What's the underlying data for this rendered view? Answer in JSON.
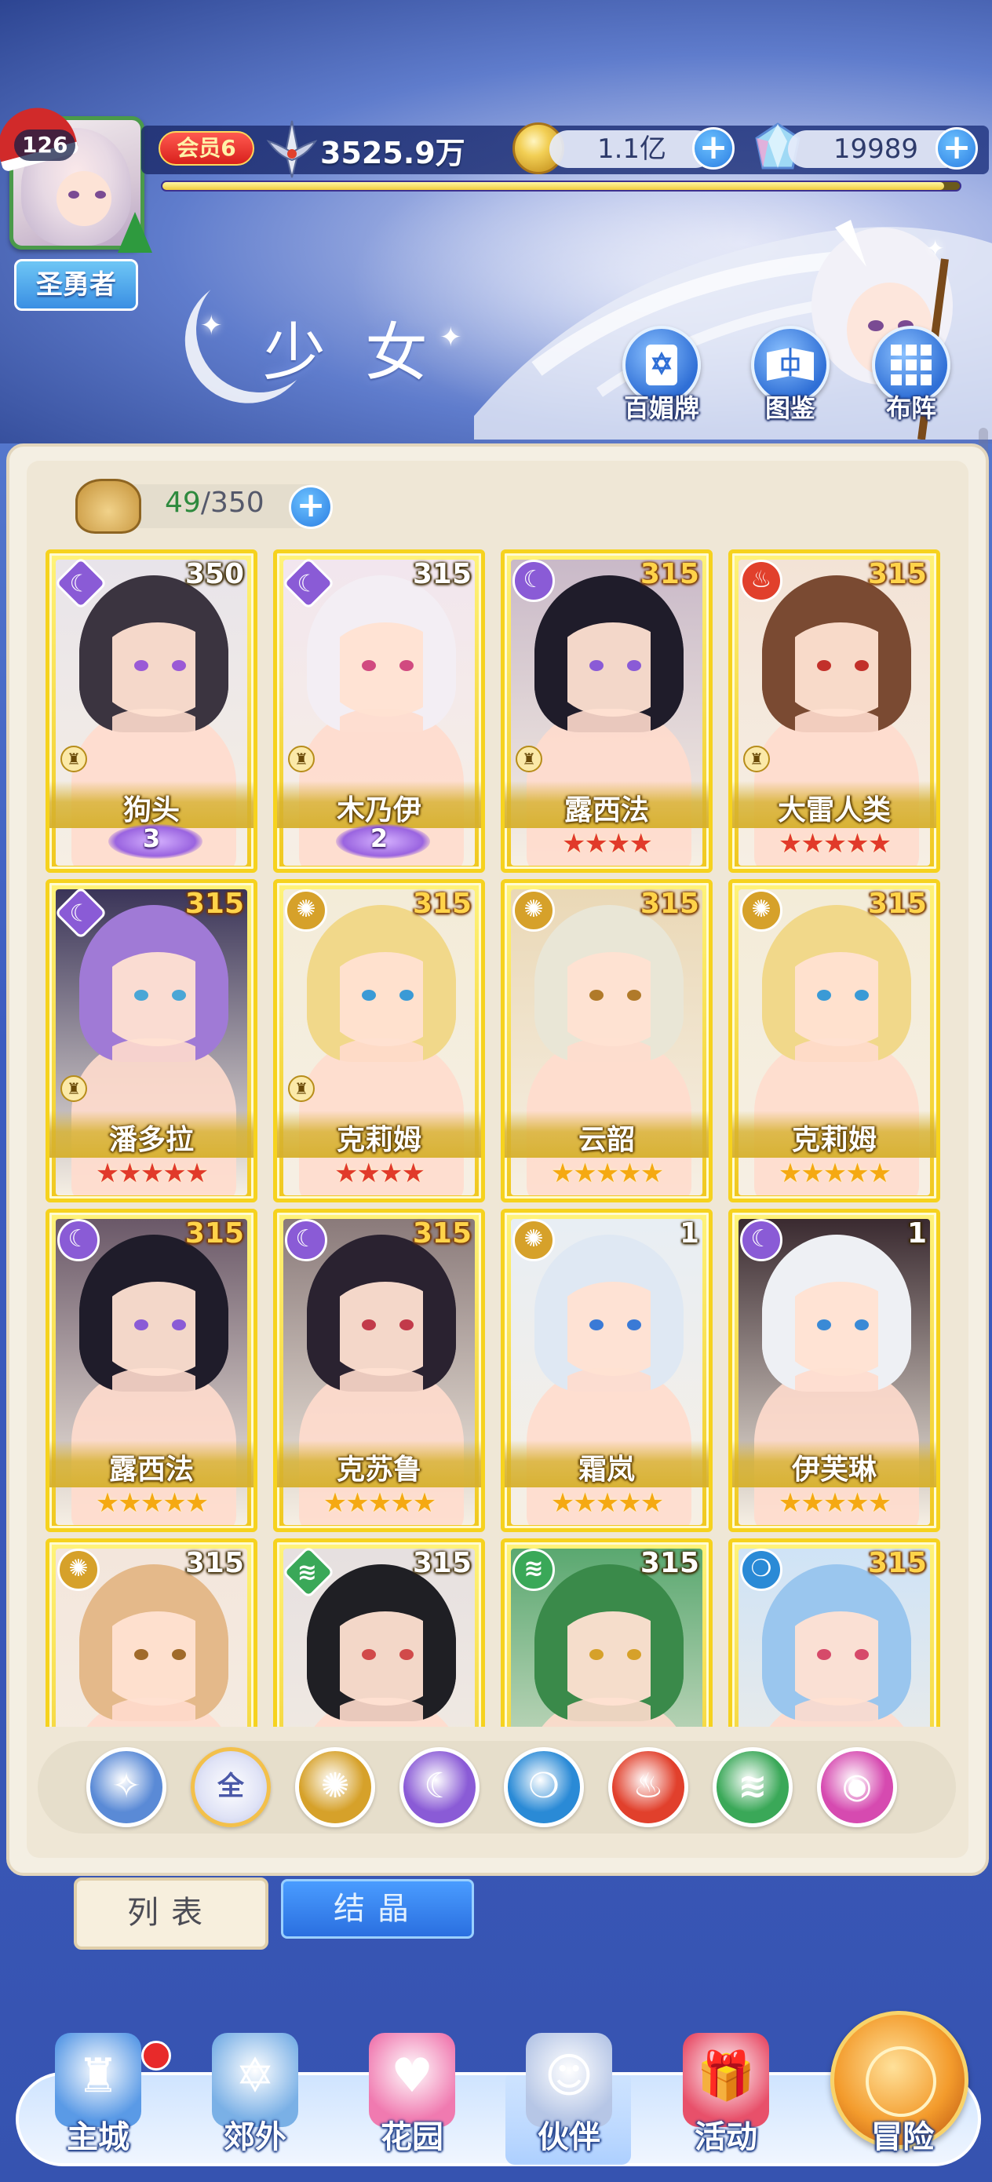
{
  "colors": {
    "card_gold": "#f0c81f",
    "moon_element": "#8a5bd6",
    "sun_element": "#d6a12a",
    "fire_element": "#e1402c",
    "wind_element": "#3aa858",
    "water_element": "#2a8ad6",
    "space_element": "#d64ab0",
    "ui_blue": "#2a7de2",
    "panel_cream": "#f4efe3"
  },
  "player": {
    "level": "126",
    "title": "圣勇者",
    "vip": "会员6",
    "power": "3525.9万",
    "gold": "1.1亿",
    "gems": "19989",
    "xp_fraction": 0.98
  },
  "header": {
    "page_title": "少女",
    "buttons": [
      {
        "label": "百媚牌",
        "icon": "card-deck-icon"
      },
      {
        "label": "图鉴",
        "icon": "book-icon"
      },
      {
        "label": "布阵",
        "icon": "formation-grid-icon"
      }
    ]
  },
  "inventory": {
    "current": "49",
    "separator": "/",
    "max": "350"
  },
  "cards": [
    {
      "name": "狗头",
      "level": "350",
      "element": "moon",
      "frame": "diamond",
      "rook": true,
      "awaken": "3",
      "stars": 0,
      "star_color": "",
      "hair": "#3b3440",
      "eye": "#9a5ad6",
      "bg": "#e8e4ea"
    },
    {
      "name": "木乃伊",
      "level": "315",
      "element": "moon",
      "frame": "diamond",
      "rook": true,
      "awaken": "2",
      "stars": 0,
      "star_color": "",
      "hair": "#f3eef4",
      "eye": "#d14a80",
      "bg": "#f2e6ee"
    },
    {
      "name": "露西法",
      "level": "315",
      "element": "moon",
      "frame": "circle",
      "rook": true,
      "awaken": "",
      "stars": 4,
      "star_color": "red",
      "hair": "#1f1c2a",
      "eye": "#8a5bd6",
      "bg": "#c9b9c8"
    },
    {
      "name": "大雷人类",
      "level": "315",
      "element": "fire",
      "frame": "circle",
      "rook": true,
      "awaken": "",
      "stars": 5,
      "star_color": "red",
      "hair": "#7a4a32",
      "eye": "#c2302a",
      "bg": "#f3e3d6"
    },
    {
      "name": "潘多拉",
      "level": "315",
      "element": "moon",
      "frame": "diamond",
      "rook": true,
      "awaken": "",
      "stars": 5,
      "star_color": "red",
      "hair": "#a07ad6",
      "eye": "#4aa6d6",
      "bg": "#3a3458"
    },
    {
      "name": "克莉姆",
      "level": "315",
      "element": "sun",
      "frame": "circle",
      "rook": true,
      "awaken": "",
      "stars": 4,
      "star_color": "red",
      "hair": "#f1d88a",
      "eye": "#3a9ad6",
      "bg": "#f3ecd8"
    },
    {
      "name": "云韶",
      "level": "315",
      "element": "sun",
      "frame": "circle",
      "rook": false,
      "awaken": "",
      "stars": 5,
      "star_color": "gold",
      "hair": "#e9e6d6",
      "eye": "#b07a2a",
      "bg": "#ead8b6"
    },
    {
      "name": "克莉姆",
      "level": "315",
      "element": "sun",
      "frame": "circle",
      "rook": false,
      "awaken": "",
      "stars": 5,
      "star_color": "gold",
      "hair": "#f1d88a",
      "eye": "#3a9ad6",
      "bg": "#f3ecd8"
    },
    {
      "name": "露西法",
      "level": "315",
      "element": "moon",
      "frame": "circle",
      "rook": false,
      "awaken": "",
      "stars": 5,
      "star_color": "gold",
      "hair": "#1f1c2a",
      "eye": "#8a5bd6",
      "bg": "#6a5868"
    },
    {
      "name": "克苏鲁",
      "level": "315",
      "element": "moon",
      "frame": "circle",
      "rook": false,
      "awaken": "",
      "stars": 5,
      "star_color": "gold",
      "hair": "#2a2230",
      "eye": "#c23a4a",
      "bg": "#8a7a7a"
    },
    {
      "name": "霜岚",
      "level": "1",
      "element": "sun",
      "frame": "circle",
      "rook": false,
      "awaken": "",
      "stars": 5,
      "star_color": "gold",
      "hair": "#dfe8f3",
      "eye": "#3a7ad6",
      "bg": "#e8eef4"
    },
    {
      "name": "伊芙琳",
      "level": "1",
      "element": "moon",
      "frame": "circle",
      "rook": false,
      "awaken": "",
      "stars": 5,
      "star_color": "gold",
      "hair": "#eef0f4",
      "eye": "#3a8ad6",
      "bg": "#3a2a30"
    },
    {
      "name": "",
      "level": "315",
      "element": "sun",
      "frame": "circle",
      "rook": false,
      "awaken": "",
      "stars": 0,
      "star_color": "",
      "hair": "#e4b98a",
      "eye": "#a06a2a",
      "bg": "#f3e6dc"
    },
    {
      "name": "",
      "level": "315",
      "element": "wind",
      "frame": "diamond",
      "rook": false,
      "awaken": "",
      "stars": 0,
      "star_color": "",
      "hair": "#1f1f24",
      "eye": "#d14a4a",
      "bg": "#e6e0e0"
    },
    {
      "name": "",
      "level": "315",
      "element": "wind",
      "frame": "circle",
      "rook": false,
      "awaken": "",
      "stars": 0,
      "star_color": "",
      "hair": "#3a8a4a",
      "eye": "#d6a12a",
      "bg": "#5aa870"
    },
    {
      "name": "",
      "level": "315",
      "element": "water",
      "frame": "circle",
      "rook": false,
      "awaken": "",
      "stars": 0,
      "star_color": "",
      "hair": "#9ac6ee",
      "eye": "#d64a6a",
      "bg": "#cfe3f6"
    }
  ],
  "filters": [
    {
      "id": "wing",
      "label": "",
      "icon": "wing-star-icon",
      "color": "#5a8ad6"
    },
    {
      "id": "all",
      "label": "全",
      "icon": "all-icon",
      "color": "#ffffff"
    },
    {
      "id": "sun",
      "label": "",
      "icon": "sun-gear-icon",
      "color": "#d6a12a"
    },
    {
      "id": "moon",
      "label": "",
      "icon": "crescent-moon-icon",
      "color": "#8a5bd6"
    },
    {
      "id": "water",
      "label": "",
      "icon": "water-drop-icon",
      "color": "#2a8ad6"
    },
    {
      "id": "fire",
      "label": "",
      "icon": "flame-icon",
      "color": "#e1402c"
    },
    {
      "id": "wind",
      "label": "",
      "icon": "whirlwind-icon",
      "color": "#3aa858"
    },
    {
      "id": "space",
      "label": "",
      "icon": "planet-icon",
      "color": "#d64ab0"
    }
  ],
  "tabs": {
    "list": "列表",
    "crystal": "结晶"
  },
  "nav": [
    {
      "label": "主城",
      "icon": "castle-icon"
    },
    {
      "label": "郊外",
      "icon": "portal-gate-icon"
    },
    {
      "label": "花园",
      "icon": "heart-garden-icon"
    },
    {
      "label": "伙伴",
      "icon": "partner-girl-icon"
    },
    {
      "label": "活动",
      "icon": "gift-box-icon"
    },
    {
      "label": "冒险",
      "icon": "compass-icon"
    }
  ]
}
